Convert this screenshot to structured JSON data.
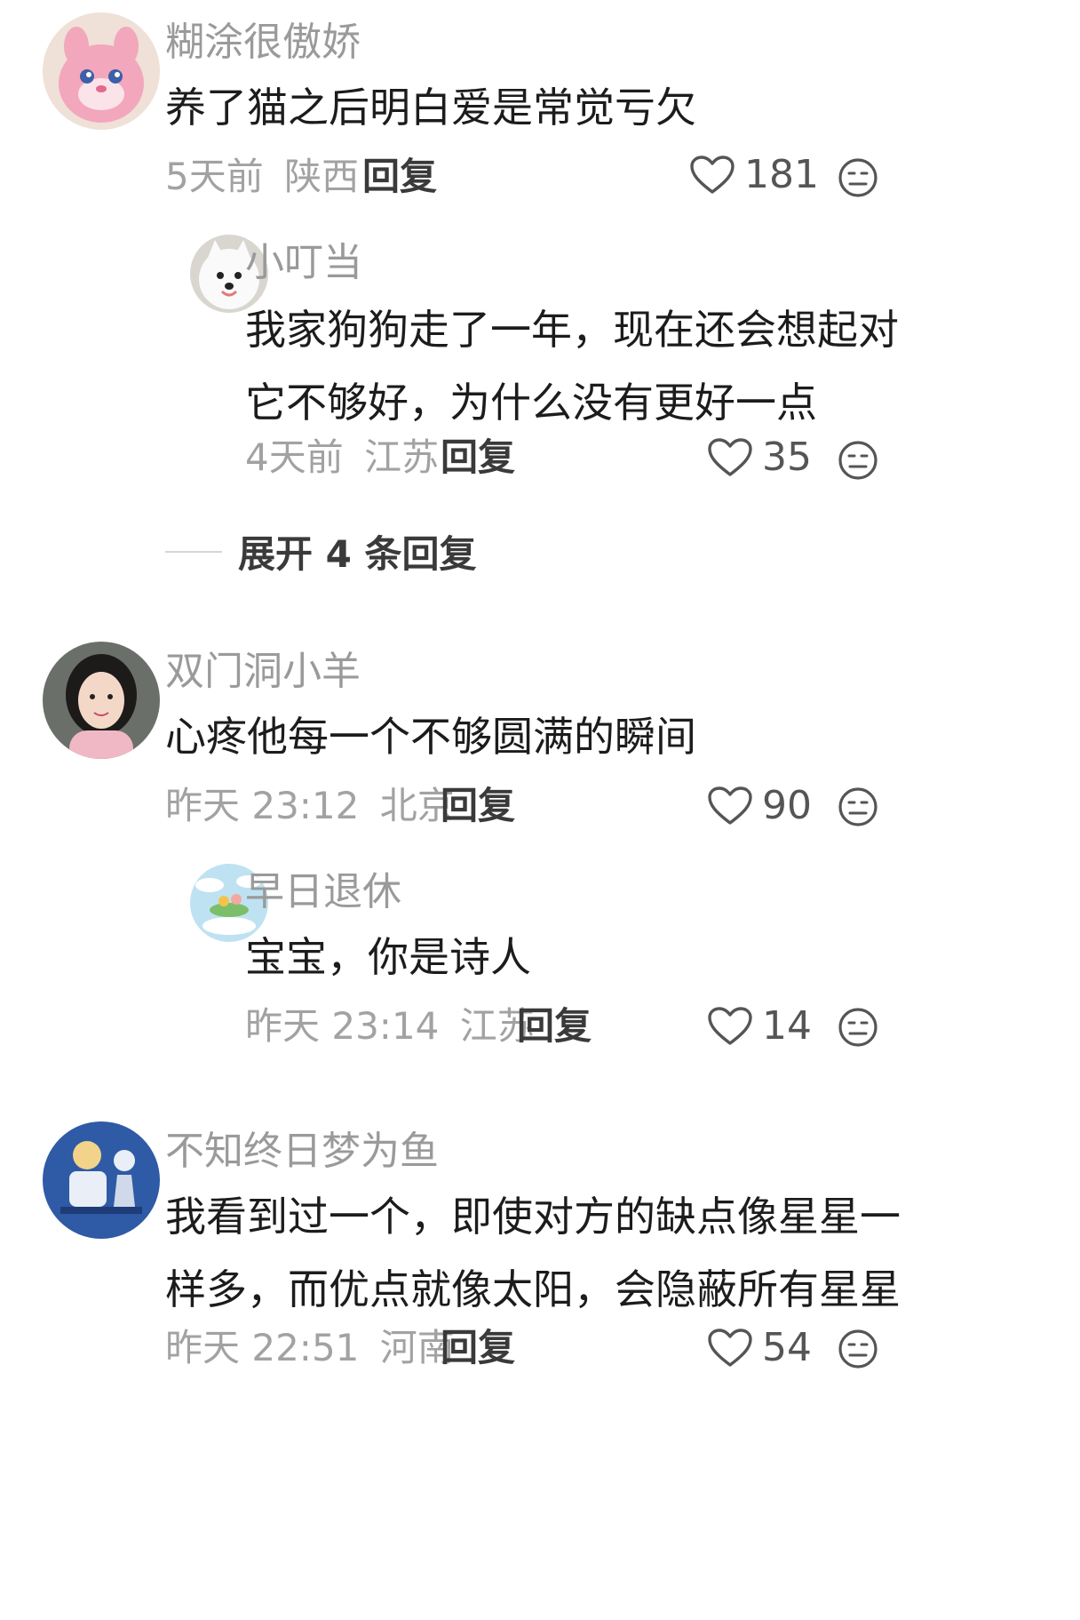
{
  "comments": [
    {
      "username": "糊涂很傲娇",
      "text_lines": [
        "养了猫之后明白爱是常觉亏欠"
      ],
      "time": "5天前",
      "location": "陕西",
      "reply_label": "回复",
      "likes": "181",
      "avatar_icon": "pink-cat-plush-avatar",
      "replies": [
        {
          "username": "小叮当",
          "text_lines": [
            "我家狗狗走了一年，现在还会想起对",
            "它不够好，为什么没有更好一点"
          ],
          "time": "4天前",
          "location": "江苏",
          "reply_label": "回复",
          "likes": "35",
          "avatar_icon": "white-dog-avatar"
        }
      ],
      "expand_label": "展开 4 条回复"
    },
    {
      "username": "双门洞小羊",
      "text_lines": [
        "心疼他每一个不够圆满的瞬间"
      ],
      "time": "昨天 23:12",
      "location": "北京",
      "reply_label": "回复",
      "likes": "90",
      "avatar_icon": "girl-portrait-avatar",
      "replies": [
        {
          "username": "早日退休",
          "text_lines": [
            "宝宝，你是诗人"
          ],
          "time": "昨天 23:14",
          "location": "江苏",
          "reply_label": "回复",
          "likes": "14",
          "avatar_icon": "sky-cartoon-avatar"
        }
      ]
    },
    {
      "username": "不知终日梦为鱼",
      "text_lines": [
        "我看到过一个，即使对方的缺点像星星一",
        "样多，而优点就像太阳，会隐蔽所有星星"
      ],
      "time": "昨天 22:51",
      "location": "河南",
      "reply_label": "回复",
      "likes": "54",
      "avatar_icon": "blue-art-avatar",
      "replies": []
    }
  ],
  "icons": {
    "like": "heart-outline-icon",
    "dislike": "neutral-face-icon"
  },
  "colors": {
    "username": "#9a9a9a",
    "meta": "#a2a2a2",
    "text": "#1c1c1c"
  }
}
